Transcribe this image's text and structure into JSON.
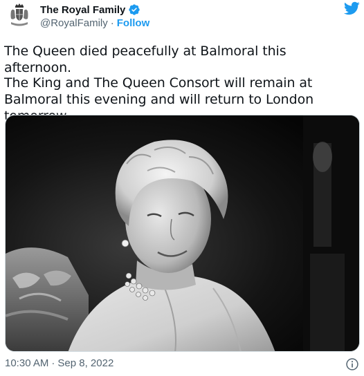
{
  "author": {
    "display_name": "The Royal Family",
    "handle": "@RoyalFamily",
    "separator": "·",
    "follow_label": "Follow",
    "verified_icon": "verified-badge-icon",
    "avatar_icon": "royal-crest-icon"
  },
  "brand": {
    "logo_icon": "twitter-bird-icon",
    "accent_color": "#1d9bf0"
  },
  "tweet": {
    "paragraph_1": "The Queen died peacefully at Balmoral this afternoon.",
    "paragraph_2": "The King and The Queen Consort will remain at Balmoral this evening and will return to London tomorrow.",
    "media_icon": "portrait-photo"
  },
  "footer": {
    "time": "10:30 AM",
    "separator": "·",
    "date": "Sep 8, 2022",
    "info_icon": "info-icon"
  }
}
